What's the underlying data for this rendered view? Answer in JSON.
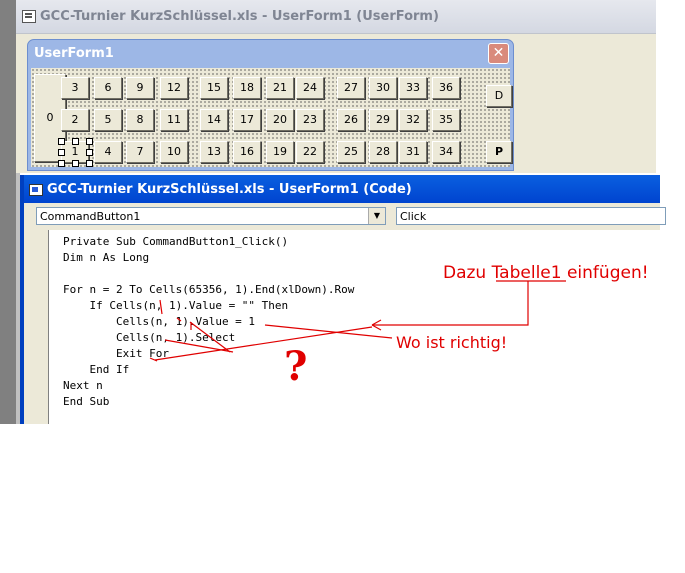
{
  "designer": {
    "title": "GCC-Turnier KurzSchlüssel.xls - UserForm1 (UserForm)",
    "userform": {
      "title": "UserForm1",
      "close_glyph": "✕",
      "button_zero": "0",
      "row1": [
        "3",
        "6",
        "9",
        "12",
        "15",
        "18",
        "21",
        "24",
        "27",
        "30",
        "33",
        "36"
      ],
      "row2": [
        "2",
        "5",
        "8",
        "11",
        "14",
        "17",
        "20",
        "23",
        "26",
        "29",
        "32",
        "35"
      ],
      "row3": [
        "1",
        "4",
        "7",
        "10",
        "13",
        "16",
        "19",
        "22",
        "25",
        "28",
        "31",
        "34"
      ],
      "button_d": "D",
      "button_p": "P"
    }
  },
  "code_window": {
    "title": "GCC-Turnier KurzSchlüssel.xls - UserForm1 (Code)",
    "object_combo": "CommandButton1",
    "procedure_combo": "Click",
    "combo_arrow": "▼",
    "lines": [
      "Private Sub CommandButton1_Click()",
      "Dim n As Long",
      "",
      "For n = 2 To Cells(65356, 1).End(xlDown).Row",
      "    If Cells(n, 1).Value = \"\" Then",
      "        Cells(n, 1).Value = 1",
      "        Cells(n, 1).Select",
      "        Exit For",
      "    End If",
      "Next n",
      "End Sub"
    ]
  },
  "annotations": {
    "note_insert": "Dazu Tabelle1 einfügen!",
    "note_where": "Wo ist richtig!",
    "question_mark": "?",
    "color": "#e00000"
  }
}
